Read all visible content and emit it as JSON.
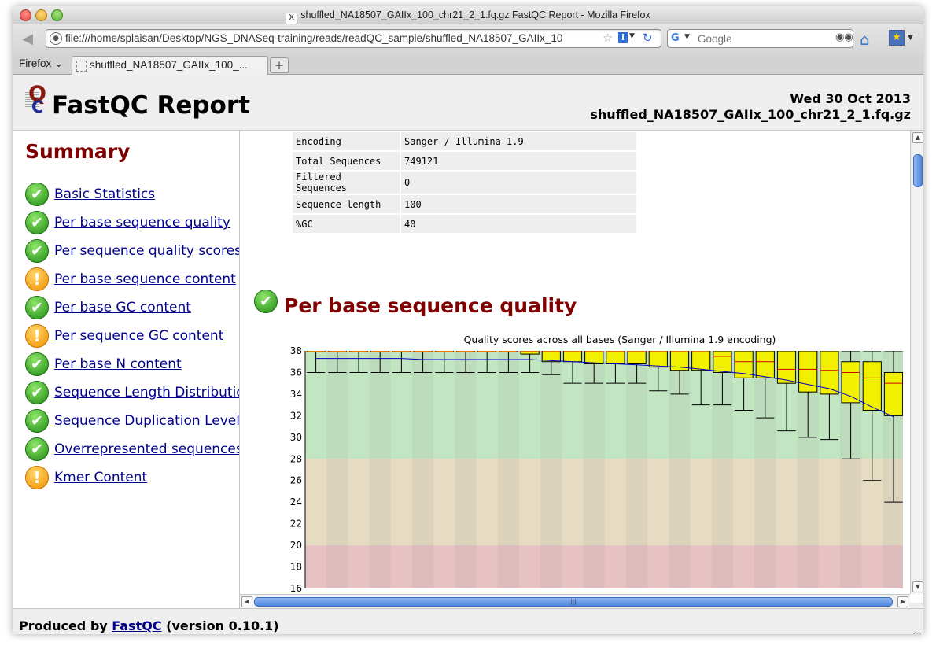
{
  "window": {
    "title": "shuffled_NA18507_GAIIx_100_chr21_2_1.fq.gz FastQC Report - Mozilla Firefox"
  },
  "toolbar": {
    "url": "file:///home/splaisan/Desktop/NGS_DNASeq-training/reads/readQC_sample/shuffled_NA18507_GAIIx_10",
    "search_placeholder": "Google",
    "firefox_menu": "Firefox",
    "tab_label": "shuffled_NA18507_GAIIx_100_...",
    "new_tab": "+"
  },
  "report": {
    "title": "FastQC Report",
    "date": "Wed 30 Oct 2013",
    "filename": "shuffled_NA18507_GAIIx_100_chr21_2_1.fq.gz"
  },
  "summary": {
    "title": "Summary",
    "modules": [
      {
        "label": "Basic Statistics",
        "status": "pass"
      },
      {
        "label": "Per base sequence quality",
        "status": "pass"
      },
      {
        "label": "Per sequence quality scores",
        "status": "pass"
      },
      {
        "label": "Per base sequence content",
        "status": "warn"
      },
      {
        "label": "Per base GC content",
        "status": "pass"
      },
      {
        "label": "Per sequence GC content",
        "status": "warn"
      },
      {
        "label": "Per base N content",
        "status": "pass"
      },
      {
        "label": "Sequence Length Distribution",
        "status": "pass"
      },
      {
        "label": "Sequence Duplication Levels",
        "status": "pass"
      },
      {
        "label": "Overrepresented sequences",
        "status": "pass"
      },
      {
        "label": "Kmer Content",
        "status": "warn"
      }
    ]
  },
  "stats": [
    [
      "Encoding",
      "Sanger / Illumina 1.9"
    ],
    [
      "Total Sequences",
      "749121"
    ],
    [
      "Filtered Sequences",
      "0"
    ],
    [
      "Sequence length",
      "100"
    ],
    [
      "%GC",
      "40"
    ]
  ],
  "section": {
    "title": "Per base sequence quality",
    "status": "pass"
  },
  "chart_data": {
    "type": "box",
    "title": "Quality scores across all bases (Sanger / Illumina 1.9 encoding)",
    "xlabel": "",
    "ylabel": "",
    "ylim": [
      16,
      38
    ],
    "yticks": [
      16,
      18,
      20,
      22,
      24,
      26,
      28,
      30,
      32,
      34,
      36,
      38
    ],
    "zones": [
      {
        "from": 28,
        "to": 38,
        "color": "#c2e6c2"
      },
      {
        "from": 20,
        "to": 28,
        "color": "#e6dcc2"
      },
      {
        "from": 0,
        "to": 20,
        "color": "#e6c2c2"
      }
    ],
    "boxes": [
      {
        "q1": 38,
        "q3": 38,
        "median": 38,
        "wlo": 36,
        "whi": 38,
        "mean": 37.3
      },
      {
        "q1": 38,
        "q3": 38,
        "median": 38,
        "wlo": 36,
        "whi": 38,
        "mean": 37.3
      },
      {
        "q1": 38,
        "q3": 38,
        "median": 38,
        "wlo": 36,
        "whi": 38,
        "mean": 37.3
      },
      {
        "q1": 38,
        "q3": 38,
        "median": 38,
        "wlo": 36,
        "whi": 38,
        "mean": 37.3
      },
      {
        "q1": 38,
        "q3": 38,
        "median": 38,
        "wlo": 36,
        "whi": 38,
        "mean": 37.3
      },
      {
        "q1": 38,
        "q3": 38,
        "median": 38,
        "wlo": 36,
        "whi": 38,
        "mean": 37.2
      },
      {
        "q1": 38,
        "q3": 38,
        "median": 38,
        "wlo": 36,
        "whi": 38,
        "mean": 37.2
      },
      {
        "q1": 38,
        "q3": 38,
        "median": 38,
        "wlo": 36,
        "whi": 38,
        "mean": 37.2
      },
      {
        "q1": 38,
        "q3": 38,
        "median": 38,
        "wlo": 36,
        "whi": 38,
        "mean": 37.2
      },
      {
        "q1": 38,
        "q3": 38,
        "median": 38,
        "wlo": 36,
        "whi": 38,
        "mean": 37.2
      },
      {
        "q1": 37.7,
        "q3": 38,
        "median": 38,
        "wlo": 36,
        "whi": 38,
        "mean": 37.2
      },
      {
        "q1": 37,
        "q3": 38,
        "median": 38,
        "wlo": 35.8,
        "whi": 38,
        "mean": 37.1
      },
      {
        "q1": 37,
        "q3": 38,
        "median": 38,
        "wlo": 35,
        "whi": 38,
        "mean": 37.0
      },
      {
        "q1": 36.8,
        "q3": 38,
        "median": 38,
        "wlo": 35,
        "whi": 38,
        "mean": 36.9
      },
      {
        "q1": 36.8,
        "q3": 38,
        "median": 38,
        "wlo": 35,
        "whi": 38,
        "mean": 36.8
      },
      {
        "q1": 36.8,
        "q3": 38,
        "median": 38,
        "wlo": 35,
        "whi": 38,
        "mean": 36.7
      },
      {
        "q1": 36.5,
        "q3": 38,
        "median": 38,
        "wlo": 34.3,
        "whi": 38,
        "mean": 36.6
      },
      {
        "q1": 36.2,
        "q3": 38,
        "median": 38,
        "wlo": 34,
        "whi": 38,
        "mean": 36.5
      },
      {
        "q1": 36.2,
        "q3": 38,
        "median": 38,
        "wlo": 33,
        "whi": 38,
        "mean": 36.3
      },
      {
        "q1": 36,
        "q3": 38,
        "median": 37.5,
        "wlo": 33,
        "whi": 38,
        "mean": 36.1
      },
      {
        "q1": 35.5,
        "q3": 38,
        "median": 37,
        "wlo": 32.5,
        "whi": 38,
        "mean": 35.9
      },
      {
        "q1": 35.5,
        "q3": 38,
        "median": 37,
        "wlo": 31.8,
        "whi": 38,
        "mean": 35.6
      },
      {
        "q1": 35,
        "q3": 38,
        "median": 36.3,
        "wlo": 30.6,
        "whi": 38,
        "mean": 35.3
      },
      {
        "q1": 34.2,
        "q3": 38,
        "median": 36.3,
        "wlo": 30,
        "whi": 38,
        "mean": 34.9
      },
      {
        "q1": 34,
        "q3": 38,
        "median": 36.2,
        "wlo": 29.8,
        "whi": 38,
        "mean": 34.5
      },
      {
        "q1": 33.2,
        "q3": 37,
        "median": 36,
        "wlo": 28,
        "whi": 38,
        "mean": 33.8
      },
      {
        "q1": 32.5,
        "q3": 37,
        "median": 35.5,
        "wlo": 26,
        "whi": 38,
        "mean": 32.8
      },
      {
        "q1": 32,
        "q3": 36,
        "median": 35,
        "wlo": 24,
        "whi": 38,
        "mean": 31.9
      }
    ]
  },
  "footer": {
    "prefix": "Produced by ",
    "link": "FastQC",
    "suffix": " (version 0.10.1)"
  }
}
